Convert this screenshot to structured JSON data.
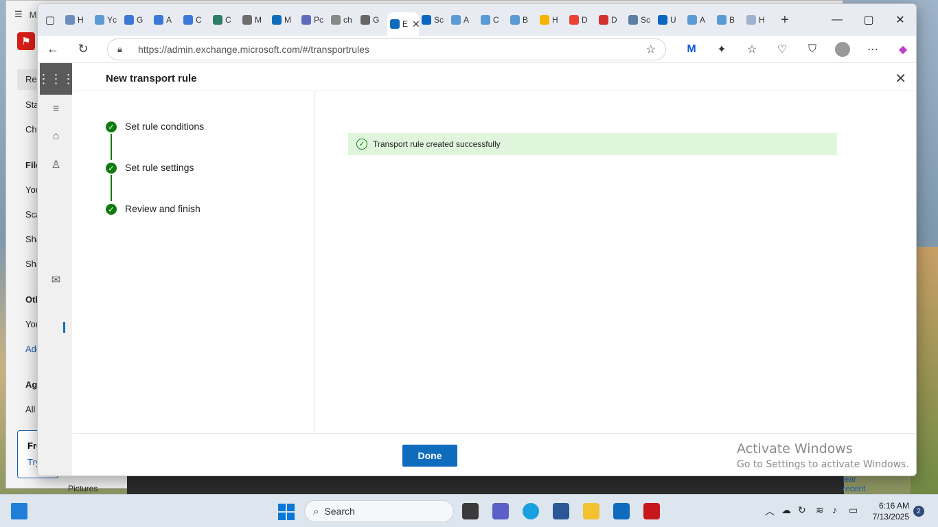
{
  "background_app": {
    "title": "M",
    "sidebar": [
      "Rec",
      "Sta",
      "Ch",
      "File",
      "You",
      "Sca",
      "Sha",
      "Sha",
      "Oth",
      "You",
      "Add",
      "Agr",
      "All"
    ],
    "promo_title": "Fre",
    "promo_link": "Try",
    "pictures_label": "Pictures",
    "clear_recent": "lear recent"
  },
  "browser": {
    "tabs": [
      {
        "label": "H",
        "color": "#6c8ebf"
      },
      {
        "label": "Yc",
        "color": "#5b9bd5"
      },
      {
        "label": "G",
        "color": "#3c78d8"
      },
      {
        "label": "A",
        "color": "#3c78d8"
      },
      {
        "label": "C",
        "color": "#3c78d8"
      },
      {
        "label": "C",
        "color": "#2e7d6b"
      },
      {
        "label": "M",
        "color": "#6d6d6d"
      },
      {
        "label": "M",
        "color": "#0f6cbd"
      },
      {
        "label": "Pc",
        "color": "#5c6bc0"
      },
      {
        "label": "ch",
        "color": "#888888"
      },
      {
        "label": "G",
        "color": "#666666"
      },
      {
        "label": "E",
        "color": "#ffffff",
        "active": true
      },
      {
        "label": "Sc",
        "color": "#0a66c2"
      },
      {
        "label": "A",
        "color": "#5b9bd5"
      },
      {
        "label": "C",
        "color": "#5b9bd5"
      },
      {
        "label": "B",
        "color": "#5b9bd5"
      },
      {
        "label": "H",
        "color": "#f4b400"
      },
      {
        "label": "D",
        "color": "#ea4335"
      },
      {
        "label": "D",
        "color": "#d32f2f"
      },
      {
        "label": "Sc",
        "color": "#5c7fa3"
      },
      {
        "label": "U",
        "color": "#0a66c2"
      },
      {
        "label": "A",
        "color": "#5b9bd5"
      },
      {
        "label": "B",
        "color": "#5b9bd5"
      },
      {
        "label": "H",
        "color": "#9fb3d1"
      }
    ],
    "url": "https://admin.exchange.microsoft.com/#/transportrules"
  },
  "panel": {
    "title": "New transport rule",
    "steps": [
      {
        "label": "Set rule conditions"
      },
      {
        "label": "Set rule settings"
      },
      {
        "label": "Review and finish"
      }
    ],
    "success_message": "Transport rule created successfully",
    "done_label": "Done"
  },
  "watermark": {
    "line1": "Activate Windows",
    "line2": "Go to Settings to activate Windows."
  },
  "taskbar": {
    "search_placeholder": "Search",
    "time": "6:16 AM",
    "date": "7/13/2025",
    "notification_count": "2"
  }
}
